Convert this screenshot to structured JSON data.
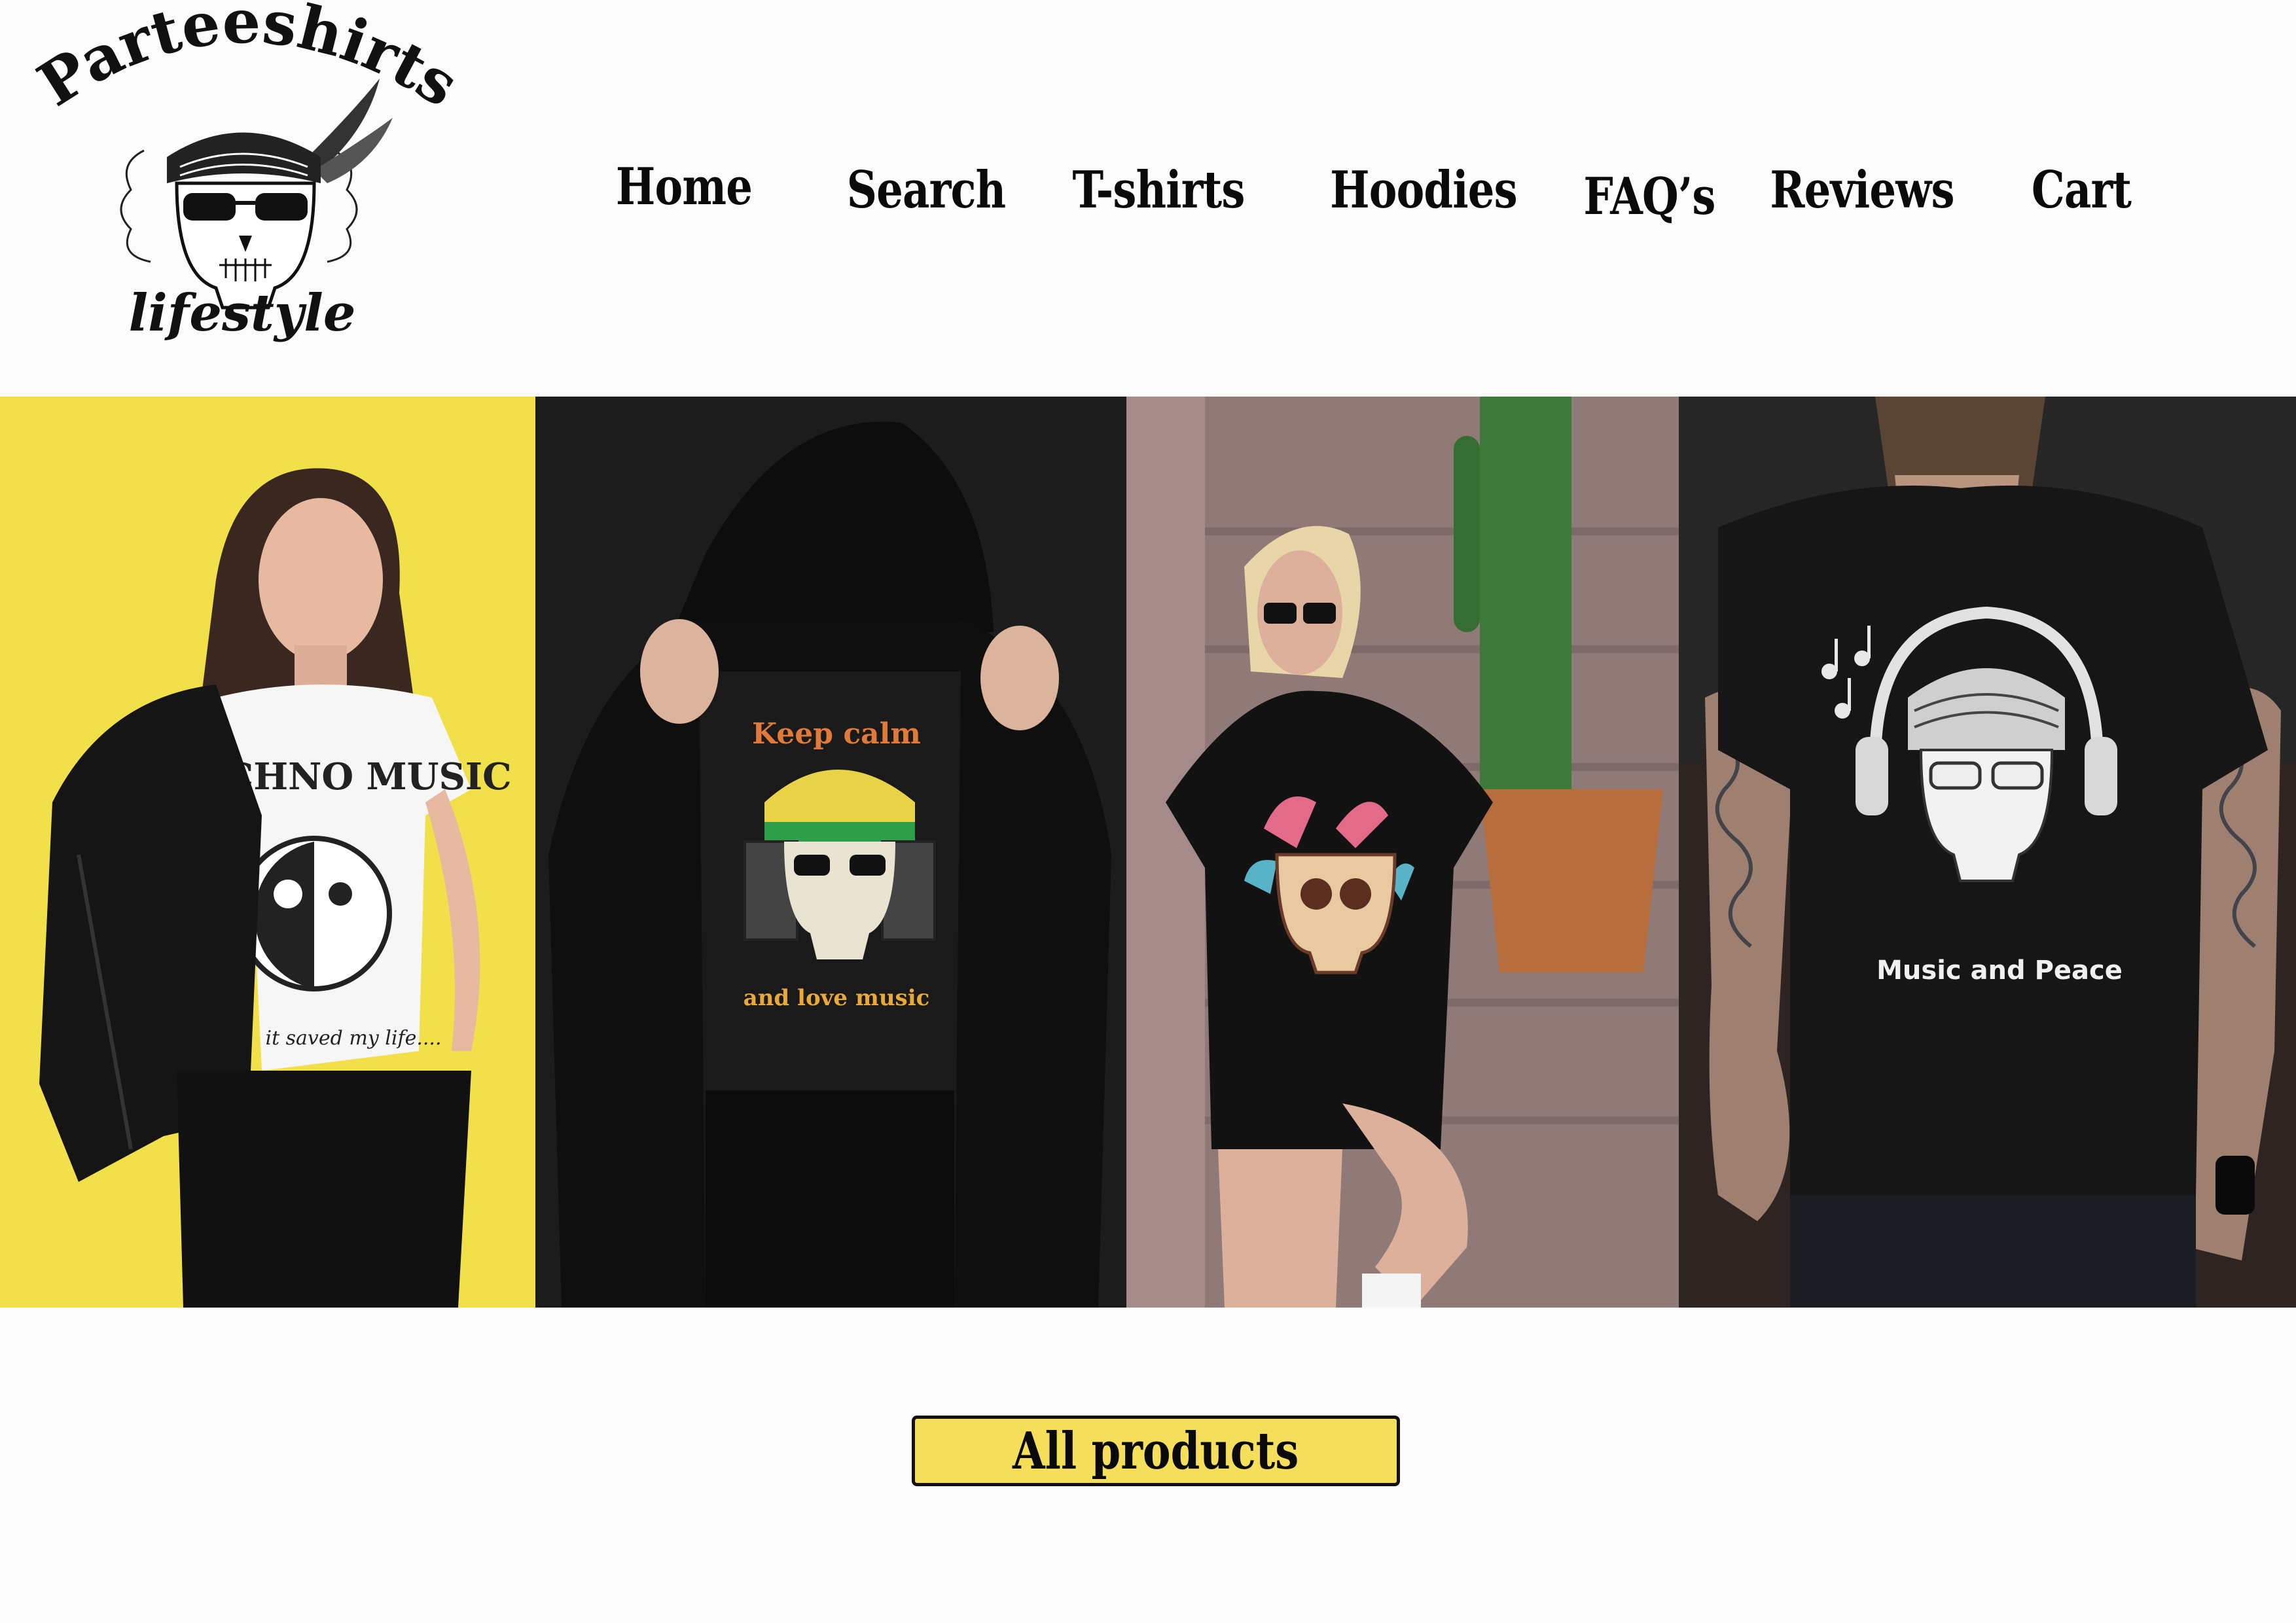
{
  "brand": {
    "name": "Parteeshirts",
    "tagline": "lifestyle"
  },
  "nav": {
    "items": [
      {
        "label": "Home"
      },
      {
        "label": "Search"
      },
      {
        "label": "T-shirts"
      },
      {
        "label": "Hoodies"
      },
      {
        "label": "FAQ’s"
      },
      {
        "label": "Reviews"
      },
      {
        "label": "Cart"
      }
    ]
  },
  "hero": {
    "panels": [
      {
        "shirt_print_top": "TECHNO MUSIC",
        "shirt_print_bottom": "it saved my life....",
        "background": "#f2e04b"
      },
      {
        "shirt_print_top": "Keep calm",
        "shirt_print_bottom": "and love music",
        "background": "#1c1c1c"
      },
      {
        "background": "#8f7a78"
      },
      {
        "shirt_print_bottom": "Music and Peace",
        "background": "#262626"
      }
    ]
  },
  "cta": {
    "label": "All products"
  },
  "colors": {
    "page_background": "#fbfbfb",
    "cta_background": "#f5df5a",
    "text": "#0a0a0a"
  }
}
